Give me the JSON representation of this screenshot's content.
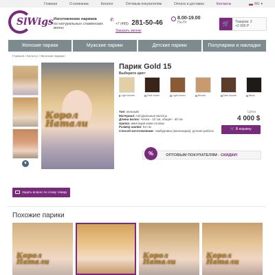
{
  "topbar": {
    "links": [
      "Главная",
      "О компании",
      "Каталог",
      "Оптовым покупателям",
      "Оплата и доставка",
      "Контакты"
    ],
    "lang": "RU"
  },
  "header": {
    "logo_text": "SlWigs",
    "tagline_bold": "Изготовление париков",
    "tagline_rest": "из натуральных славянских волос",
    "phone_prefix": "+7 (495)",
    "phone_number": "281-50-46",
    "call_link": "Заказать звонок",
    "hours": "8.00-19.00",
    "days": "Пн-Пт",
    "cart_items": "Товаров: 2",
    "cart_total": "+2 000 Р"
  },
  "nav": [
    "Женские парики",
    "Мужские парики",
    "Детские парики",
    "Полупарики и накладки"
  ],
  "breadcrumb": "Главная / Каталог / Женские парики /",
  "product": {
    "title": "Парик Gold 15",
    "choose_color": "Выберите цвет:",
    "swatches": [
      {
        "label": "Light blonde",
        "color": "#e3cfa6"
      },
      {
        "label": "Dark brown",
        "color": "#3a2418"
      },
      {
        "label": "Light brown",
        "color": "#8a5a34"
      },
      {
        "label": "Blonde",
        "color": "#c89a6e"
      },
      {
        "label": "Dark blonde",
        "color": "#5a3d2a"
      },
      {
        "label": "Black",
        "color": "#1f1a17"
      }
    ],
    "specs": [
      {
        "k": "Тип:",
        "v": " женский"
      },
      {
        "k": "Материал:",
        "v": " натуральные волосы"
      },
      {
        "k": "Длина волос:",
        "v": " челка - 10 см, общая - 40 см"
      },
      {
        "k": "Шапка:",
        "v": " имитация кожи головы"
      },
      {
        "k": "Размер шапки:",
        "v": " 54 см"
      },
      {
        "k": "Способ изготовления:",
        "v": " тамбуровка (монопарик), ручная работа"
      }
    ],
    "price_label": "Цена",
    "price": "4 000 $",
    "buy_label": "В корзину",
    "promo_text": "ОПТОВЫМ ПОКУПАТЕЛЯМ - ",
    "promo_highlight": "СКИДКИ!",
    "promo_badge": "%",
    "watermark": "Корол Натали",
    "ask_label": "Задать вопрос по этому товару"
  },
  "similar": {
    "title": "Похожие парики",
    "watermark": "Корол Натали"
  },
  "colors": {
    "accent": "#7a2a7c",
    "nav": "#7d8b8e"
  }
}
